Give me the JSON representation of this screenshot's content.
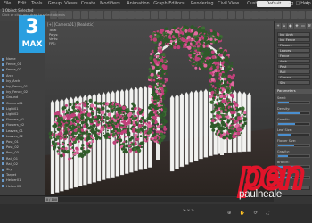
{
  "app": {
    "logo_number": "3",
    "logo_text": "MAX",
    "brand_color": "#2a9fe0"
  },
  "menubar": {
    "items": [
      "File",
      "Edit",
      "Tools",
      "Group",
      "Views",
      "Create",
      "Modifiers",
      "Animation",
      "Graph Editors",
      "Rendering",
      "Civil View",
      "Customize",
      "Scripting",
      "Help"
    ],
    "workspace": "Default",
    "window_buttons": "– □ ×"
  },
  "explorer": {
    "rows": [
      "Name",
      "Fence_01",
      "Fence_02",
      "Arch",
      "Ivy_Arch",
      "Ivy_Fence_01",
      "Ivy_Fence_02",
      "Ground",
      "Camera01",
      "Light01",
      "Light02",
      "Flowers_01",
      "Flowers_02",
      "Leaves_01",
      "Leaves_02",
      "Post_01",
      "Post_02",
      "Post_03",
      "Rail_01",
      "Rail_02",
      "Sky",
      "Target",
      "Helper01",
      "Helper02"
    ]
  },
  "viewport": {
    "label": "[+] [Camera01] [Realistic]",
    "hud": [
      "Total",
      "Polys:",
      "Verts:",
      "FPS:"
    ],
    "hud_values": [
      "",
      "",
      "",
      ""
    ]
  },
  "command_panel": {
    "tabs": [
      "+",
      "⌂",
      "◐",
      "⎈",
      "▭",
      "⚒"
    ],
    "object_list": [
      "Ivy_Arch",
      "Ivy_Fence",
      "Flowers",
      "Leaves",
      "Fence",
      "Arch",
      "Post",
      "Rail",
      "Ground",
      "Sky"
    ],
    "section_title": "Parameters",
    "param_labels": [
      "Seed:",
      "Density:",
      "Growth:",
      "Leaf Size:",
      "Flower Size:",
      "Gravity:",
      "Branch:",
      "Random:"
    ],
    "param_levels": [
      0.35,
      0.7,
      0.55,
      0.4,
      0.5,
      0.3,
      0.6,
      0.45
    ],
    "button_label": "Grow"
  },
  "timeline": {
    "slider_label": "0 / 100"
  },
  "status": {
    "line1": "1 Object Selected",
    "line2": "Click or click-and-drag to select objects"
  },
  "coords": "X:  Y:  Z:",
  "nav_icons": "⊕ ✋ ⟳ ⛶",
  "watermark": {
    "logo": "pen",
    "text": "paulneale",
    "color": "#e0142a"
  }
}
